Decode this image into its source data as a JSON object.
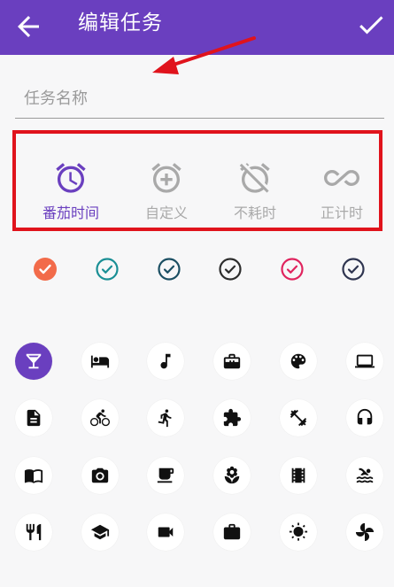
{
  "appbar": {
    "title": "编辑任务",
    "background": "#6a3fbf"
  },
  "name_field": {
    "placeholder": "任务名称",
    "value": ""
  },
  "modes": [
    {
      "id": "pomodoro",
      "label": "番茄时间",
      "icon": "alarm-clock-icon",
      "active": true
    },
    {
      "id": "custom",
      "label": "自定义",
      "icon": "alarm-add-icon",
      "active": false
    },
    {
      "id": "untimed",
      "label": "不耗时",
      "icon": "alarm-off-icon",
      "active": false
    },
    {
      "id": "countup",
      "label": "正计时",
      "icon": "infinity-icon",
      "active": false
    }
  ],
  "colors": [
    {
      "hex": "#f26b4a",
      "filled": true
    },
    {
      "hex": "#1a8f95",
      "filled": false
    },
    {
      "hex": "#1b4f63",
      "filled": false
    },
    {
      "hex": "#2d2d2d",
      "filled": false
    },
    {
      "hex": "#e0245e",
      "filled": false
    },
    {
      "hex": "#2f3550",
      "filled": false
    }
  ],
  "icons": [
    "cocktail-icon",
    "bed-icon",
    "music-note-icon",
    "briefcase-tools-icon",
    "palette-icon",
    "laptop-icon",
    "document-icon",
    "cycling-icon",
    "running-icon",
    "puzzle-icon",
    "dumbbell-icon",
    "headphones-icon",
    "book-icon",
    "camera-icon",
    "coffee-cup-icon",
    "flower-icon",
    "film-icon",
    "swimming-icon",
    "restaurant-icon",
    "graduation-cap-icon",
    "video-camera-icon",
    "work-bag-icon",
    "sun-icon",
    "pinwheel-icon"
  ],
  "selected_icon": "cocktail-icon"
}
